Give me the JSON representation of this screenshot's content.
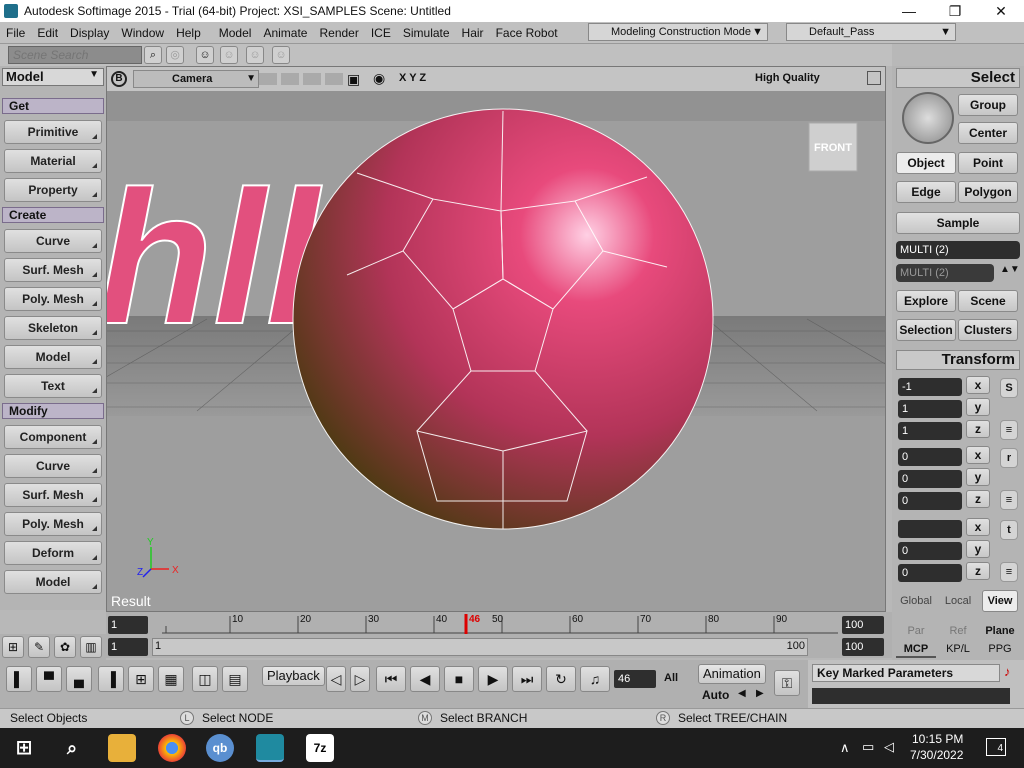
{
  "window": {
    "title": "Autodesk Softimage 2015 - Trial (64-bit)     Project: XSI_SAMPLES     Scene: Untitled",
    "minimize": "—",
    "maximize": "❐",
    "close": "✕"
  },
  "menu": [
    "File",
    "Edit",
    "Display",
    "Window",
    "Help",
    "Model",
    "Animate",
    "Render",
    "ICE",
    "Simulate",
    "Hair",
    "Face Robot"
  ],
  "mode_combo": "Modeling Construction Mode",
  "pass_combo": "Default_Pass",
  "search": {
    "placeholder": "Scene Search"
  },
  "left_panel": {
    "title": "Model",
    "sections": [
      {
        "label": "Get",
        "items": [
          "Primitive",
          "Material",
          "Property"
        ]
      },
      {
        "label": "Create",
        "items": [
          "Curve",
          "Surf. Mesh",
          "Poly. Mesh",
          "Skeleton",
          "Model",
          "Text"
        ]
      },
      {
        "label": "Modify",
        "items": [
          "Component",
          "Curve",
          "Surf. Mesh",
          "Poly. Mesh",
          "Deform",
          "Model"
        ]
      }
    ]
  },
  "viewport": {
    "badge": "B",
    "camera": "Camera",
    "axes": "X Y Z",
    "quality": "High Quality",
    "view_cube": "FRONT",
    "result": "Result",
    "text_3d": "hllo:"
  },
  "right_panel": {
    "select_title": "Select",
    "select_buttons": [
      "Group",
      "Center",
      "Object",
      "Point",
      "Edge",
      "Polygon",
      "Sample"
    ],
    "multi1": "MULTI (2)",
    "multi2": "MULTI (2)",
    "explore": [
      "Explore",
      "Scene",
      "Selection",
      "Clusters"
    ],
    "transform_title": "Transform",
    "scale": [
      "-1",
      "1",
      "1"
    ],
    "rotate": [
      "0",
      "0",
      "0"
    ],
    "translate": [
      "",
      "0",
      "0"
    ],
    "axes": [
      "x",
      "y",
      "z"
    ],
    "transform_icons": [
      "S",
      "r",
      "t"
    ],
    "tabs1": [
      "Global",
      "Local",
      "View"
    ],
    "tabs2": [
      "Par",
      "Ref",
      "Plane"
    ],
    "tabs3": [
      "MCP",
      "KP/L",
      "PPG"
    ]
  },
  "timeline": {
    "start": "1",
    "end": "100",
    "range_start": "1",
    "range_start2": "1",
    "range_end": "100",
    "range_end2": "100",
    "ticks": [
      "10",
      "20",
      "30",
      "40",
      "50",
      "60",
      "70",
      "80",
      "90"
    ],
    "current": "46"
  },
  "toolbar": {
    "playback": "Playback",
    "frame": "46",
    "all": "All",
    "animation": "Animation",
    "auto": "Auto",
    "kmp": "Key Marked Parameters"
  },
  "status": {
    "left": "Select Objects",
    "l": "L",
    "l_text": "Select NODE",
    "m": "M",
    "m_text": "Select BRANCH",
    "r": "R",
    "r_text": "Select TREE/CHAIN"
  },
  "taskbar": {
    "time": "10:15 PM",
    "date": "7/30/2022",
    "notif": "4",
    "qb": "qb",
    "zip": "7z"
  }
}
